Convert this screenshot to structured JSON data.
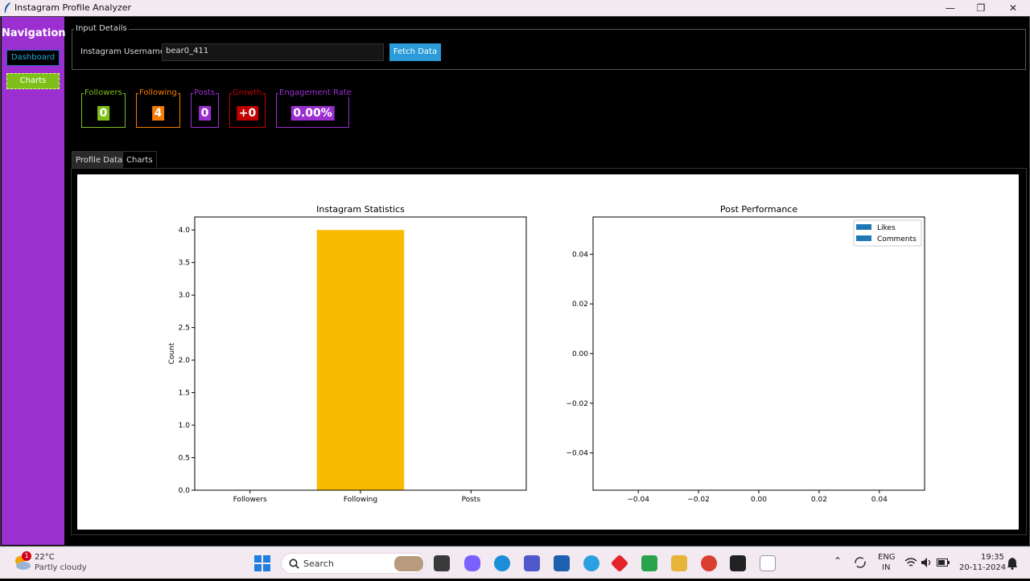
{
  "window": {
    "title": "Instagram Profile Analyzer"
  },
  "sidebar": {
    "title": "Navigation",
    "items": [
      {
        "label": "Dashboard"
      },
      {
        "label": "Charts"
      }
    ]
  },
  "input_details": {
    "legend": "Input Details",
    "username_label": "Instagram Username:",
    "username_value": "bear0_411",
    "fetch_label": "Fetch Data"
  },
  "stats": [
    {
      "label": "Followers",
      "value": "0",
      "color": "#7fbf1a"
    },
    {
      "label": "Following",
      "value": "4",
      "color": "#f57c00"
    },
    {
      "label": "Posts",
      "value": "0",
      "color": "#9b2fd0"
    },
    {
      "label": "Growth",
      "value": "+0",
      "color": "#c00000"
    },
    {
      "label": "Engagement Rate",
      "value": "0.00%",
      "color": "#9b2fd0"
    }
  ],
  "tabs": [
    {
      "label": "Profile Data"
    },
    {
      "label": "Charts"
    }
  ],
  "chart_data": [
    {
      "type": "bar",
      "title": "Instagram Statistics",
      "ylabel": "Count",
      "xlabel": "",
      "categories": [
        "Followers",
        "Following",
        "Posts"
      ],
      "values": [
        0,
        4,
        0
      ],
      "colors": [
        "#7fbf1a",
        "#f9bb00",
        "#9b2fd0"
      ],
      "ylim": [
        0,
        4.2
      ],
      "yticks": [
        "0.0",
        "0.5",
        "1.0",
        "1.5",
        "2.0",
        "2.5",
        "3.0",
        "3.5",
        "4.0"
      ],
      "grid": false
    },
    {
      "type": "bar",
      "title": "Post Performance",
      "series": [
        {
          "name": "Likes",
          "values": []
        },
        {
          "name": "Comments",
          "values": []
        }
      ],
      "series_color": "#1f77b4",
      "xticks": [
        "−0.04",
        "−0.02",
        "0.00",
        "0.02",
        "0.04"
      ],
      "yticks": [
        "0.04",
        "0.02",
        "0.00",
        "−0.02",
        "−0.04"
      ],
      "xlim": [
        -0.055,
        0.055
      ],
      "ylim": [
        -0.055,
        0.055
      ],
      "legend": "top-right",
      "grid": false
    }
  ],
  "taskbar": {
    "weather_temp": "22°C",
    "weather_desc": "Partly cloudy",
    "weather_badge": "1",
    "search_label": "Search",
    "lang": "ENG",
    "region": "IN",
    "time": "19:35",
    "date": "20-11-2024"
  }
}
